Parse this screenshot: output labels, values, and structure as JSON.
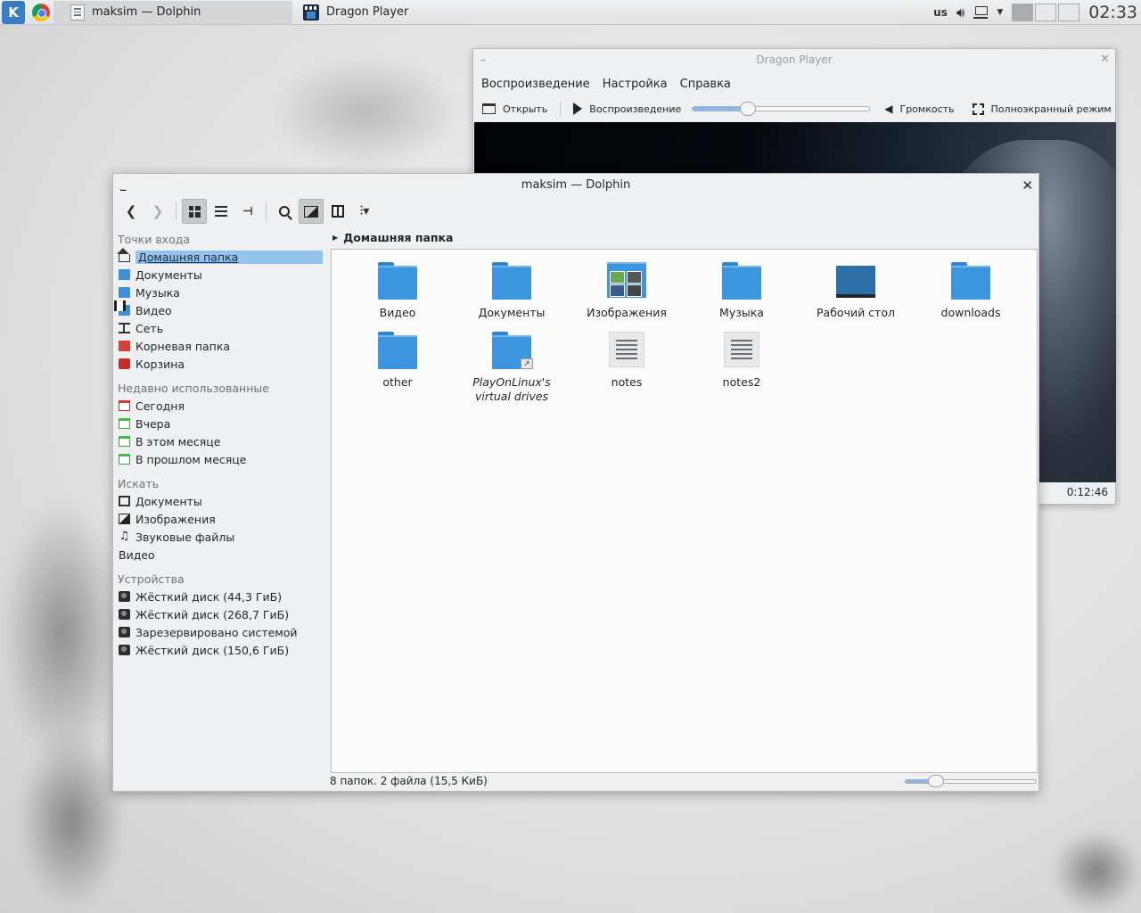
{
  "panel": {
    "tasks": [
      {
        "title": "maksim — Dolphin"
      },
      {
        "title": "Dragon Player"
      }
    ],
    "keyboard_layout": "us",
    "clock": "02:33"
  },
  "dragon": {
    "title": "Dragon Player",
    "menu": [
      "Воспроизведение",
      "Настройка",
      "Справка"
    ],
    "toolbar": {
      "open": "Открыть",
      "play": "Воспроизведение",
      "volume": "Громкость",
      "fullscreen": "Полноэкранный режим"
    },
    "seek_fraction": 0.31,
    "time": "0:12:46"
  },
  "dolphin": {
    "title": "maksim — Dolphin",
    "places": {
      "entry_header": "Точки входа",
      "entries": [
        {
          "label": "Домашняя папка",
          "icon": "home-icon"
        },
        {
          "label": "Документы",
          "icon": "folder-icon"
        },
        {
          "label": "Музыка",
          "icon": "folder-icon"
        },
        {
          "label": "Видео",
          "icon": "folder-icon"
        },
        {
          "label": "Сеть",
          "icon": "network-icon"
        },
        {
          "label": "Корневая папка",
          "icon": "root-folder-icon"
        },
        {
          "label": "Корзина",
          "icon": "trash-icon"
        }
      ],
      "recent_header": "Недавно использованные",
      "recent": [
        {
          "label": "Сегодня",
          "icon": "calendar-today-icon"
        },
        {
          "label": "Вчера",
          "icon": "calendar-icon"
        },
        {
          "label": "В этом месяце",
          "icon": "calendar-icon"
        },
        {
          "label": "В прошлом месяце",
          "icon": "calendar-icon"
        }
      ],
      "search_header": "Искать",
      "search": [
        {
          "label": "Документы",
          "icon": "document-icon"
        },
        {
          "label": "Изображения",
          "icon": "image-icon"
        },
        {
          "label": "Звуковые файлы",
          "icon": "audio-icon"
        },
        {
          "label": "Видео",
          "icon": "video-icon"
        }
      ],
      "devices_header": "Устройства",
      "devices": [
        {
          "label": "Жёсткий диск (44,3 ГиБ)",
          "icon": "disk-icon"
        },
        {
          "label": "Жёсткий диск (268,7 ГиБ)",
          "icon": "disk-icon"
        },
        {
          "label": "Зарезервировано системой",
          "icon": "disk-icon"
        },
        {
          "label": "Жёсткий диск (150,6 ГиБ)",
          "icon": "disk-icon"
        }
      ]
    },
    "breadcrumb": "Домашняя папка",
    "files": [
      {
        "name": "Видео",
        "type": "folder"
      },
      {
        "name": "Документы",
        "type": "folder"
      },
      {
        "name": "Изображения",
        "type": "images-folder"
      },
      {
        "name": "Музыка",
        "type": "folder"
      },
      {
        "name": "Рабочий стол",
        "type": "desktop-folder"
      },
      {
        "name": "downloads",
        "type": "folder"
      },
      {
        "name": "other",
        "type": "folder"
      },
      {
        "name": "PlayOnLinux's virtual drives",
        "type": "link-folder"
      },
      {
        "name": "notes",
        "type": "text"
      },
      {
        "name": "notes2",
        "type": "text"
      }
    ],
    "status": "8 папок. 2 файла (15,5 КиБ)",
    "zoom_fraction": 0.23
  }
}
